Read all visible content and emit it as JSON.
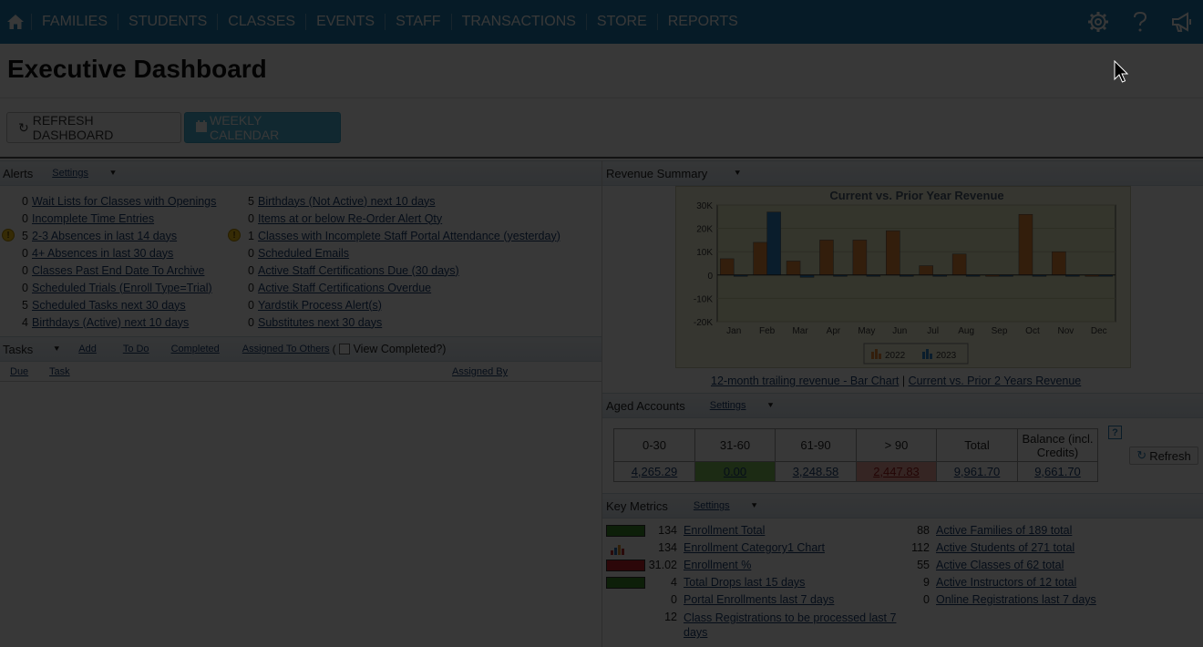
{
  "nav": {
    "items": [
      "FAMILIES",
      "STUDENTS",
      "CLASSES",
      "EVENTS",
      "STAFF",
      "TRANSACTIONS",
      "STORE",
      "REPORTS"
    ]
  },
  "page": {
    "title": "Executive Dashboard"
  },
  "buttons": {
    "refresh": "REFRESH DASHBOARD",
    "calendar": "WEEKLY CALENDAR"
  },
  "alerts": {
    "title": "Alerts",
    "settings": "Settings",
    "left": [
      {
        "count": "0",
        "label": "Wait Lists for Classes with Openings",
        "warn": false
      },
      {
        "count": "0",
        "label": "Incomplete Time Entries",
        "warn": false
      },
      {
        "count": "5",
        "label": "2-3 Absences in last 14 days",
        "warn": true
      },
      {
        "count": "0",
        "label": "4+ Absences in last 30 days",
        "warn": false
      },
      {
        "count": "0",
        "label": "Classes Past End Date To Archive",
        "warn": false
      },
      {
        "count": "0",
        "label": "Scheduled Trials (Enroll Type=Trial)",
        "warn": false
      },
      {
        "count": "5",
        "label": "Scheduled Tasks next 30 days",
        "warn": false
      },
      {
        "count": "4",
        "label": "Birthdays (Active) next 10 days",
        "warn": false
      }
    ],
    "right": [
      {
        "count": "5",
        "label": "Birthdays (Not Active) next 10 days",
        "warn": false
      },
      {
        "count": "0",
        "label": "Items at or below Re-Order Alert Qty",
        "warn": false
      },
      {
        "count": "1",
        "label": "Classes with Incomplete Staff Portal Attendance (yesterday)",
        "warn": true
      },
      {
        "count": "0",
        "label": "Scheduled Emails",
        "warn": false
      },
      {
        "count": "0",
        "label": "Active Staff Certifications Due (30 days)",
        "warn": false
      },
      {
        "count": "0",
        "label": "Active Staff Certifications Overdue",
        "warn": false
      },
      {
        "count": "0",
        "label": "Yardstik Process Alert(s)",
        "warn": false
      },
      {
        "count": "0",
        "label": "Substitutes next 30 days",
        "warn": false
      }
    ]
  },
  "tasks": {
    "title": "Tasks",
    "add": "Add",
    "todo": "To Do",
    "completed": "Completed",
    "assigned": "Assigned To Others",
    "paren": "(",
    "view_completed": "View Completed?)",
    "col_due": "Due",
    "col_task": "Task",
    "col_assigned": "Assigned By"
  },
  "revenue": {
    "title": "Revenue Summary",
    "link1": "12-month trailing revenue - Bar Chart",
    "sep": "|",
    "link2": "Current vs. Prior 2 Years Revenue"
  },
  "chart_data": {
    "type": "bar",
    "title": "Current vs. Prior Year Revenue",
    "categories": [
      "Jan",
      "Feb",
      "Mar",
      "Apr",
      "May",
      "Jun",
      "Jul",
      "Aug",
      "Sep",
      "Oct",
      "Nov",
      "Dec"
    ],
    "series": [
      {
        "name": "2022",
        "values": [
          7000,
          14000,
          6000,
          15000,
          15000,
          19000,
          4000,
          9000,
          0,
          26000,
          10000,
          0
        ]
      },
      {
        "name": "2023",
        "values": [
          0,
          27000,
          -1000,
          0,
          0,
          0,
          0,
          0,
          0,
          0,
          0,
          0
        ]
      }
    ],
    "yticks": [
      "30K",
      "20K",
      "10K",
      "0",
      "-10K",
      "-20K"
    ],
    "ylim": [
      -20000,
      30000
    ],
    "legend": "bottom",
    "colors": {
      "2022": "#e8873a",
      "2023": "#2e86c9"
    }
  },
  "aged": {
    "title": "Aged Accounts",
    "settings": "Settings",
    "headers": [
      "0-30",
      "31-60",
      "61-90",
      "> 90",
      "Total",
      "Balance (incl. Credits)"
    ],
    "values": [
      "4,265.29",
      "0.00",
      "3,248.58",
      "2,447.83",
      "9,961.70",
      "9,661.70"
    ],
    "refresh": "Refresh",
    "help": "?"
  },
  "metrics": {
    "title": "Key Metrics",
    "settings": "Settings",
    "left": [
      {
        "num": "134",
        "label": "Enrollment Total",
        "bar": "#3c8c2c"
      },
      {
        "num": "134",
        "label": "Enrollment Category1 Chart",
        "bar": "chart"
      },
      {
        "num": "31.02",
        "label": "Enrollment %",
        "bar": "#c8202a"
      },
      {
        "num": "4",
        "label": "Total Drops last 15 days",
        "bar": "#3c8c2c"
      },
      {
        "num": "0",
        "label": "Portal Enrollments last 7 days",
        "bar": ""
      },
      {
        "num": "12",
        "label": "Class Registrations to be processed last 7 days",
        "bar": ""
      }
    ],
    "right": [
      {
        "num": "88",
        "label": "Active Families of 189 total"
      },
      {
        "num": "112",
        "label": "Active Students of 271 total"
      },
      {
        "num": "55",
        "label": "Active Classes of 62 total"
      },
      {
        "num": "9",
        "label": "Active Instructors of 12 total"
      },
      {
        "num": "0",
        "label": "Online Registrations last 7 days"
      }
    ]
  }
}
